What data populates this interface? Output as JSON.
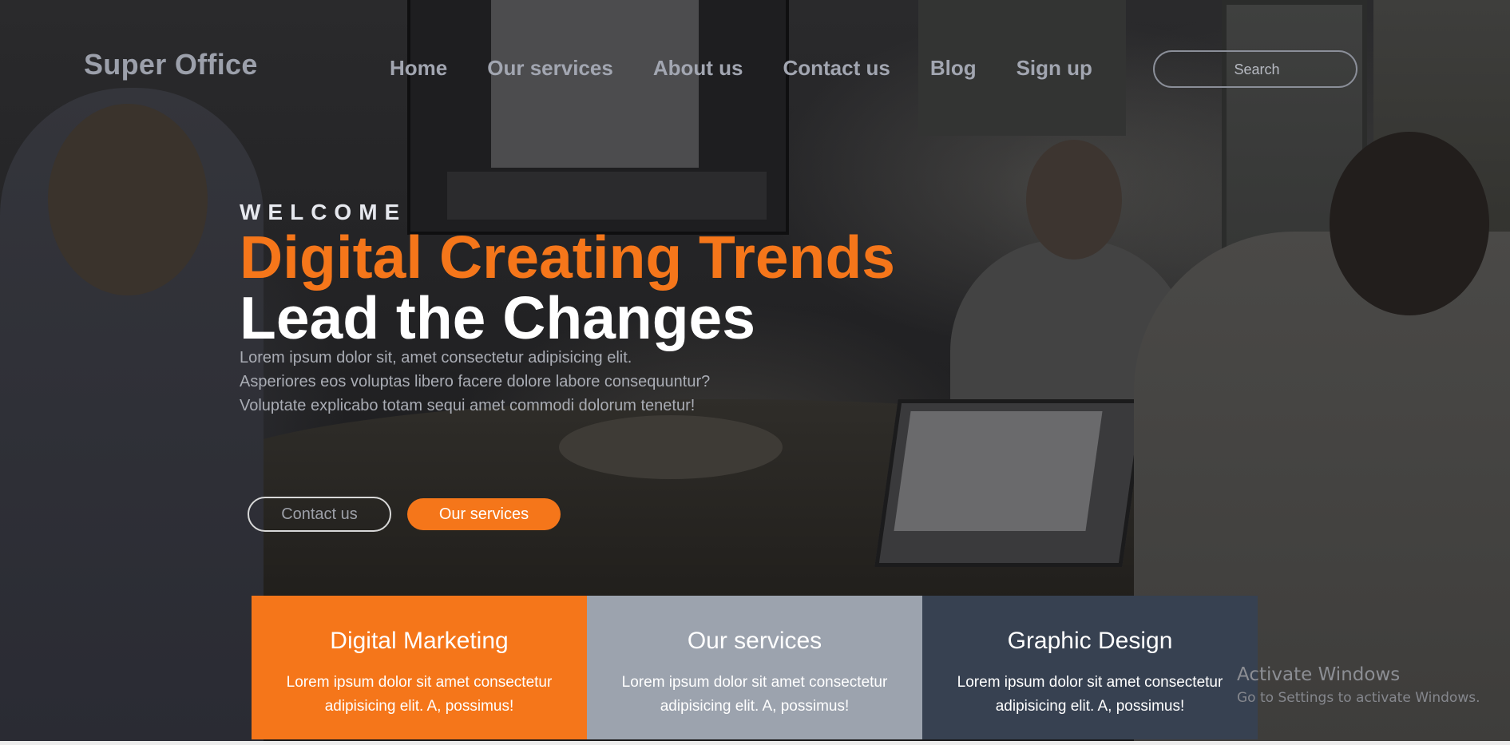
{
  "brand": "Super Office",
  "nav": {
    "items": [
      "Home",
      "Our services",
      "About us",
      "Contact us",
      "Blog",
      "Sign up"
    ]
  },
  "search": {
    "placeholder": "Search",
    "value": ""
  },
  "hero": {
    "kicker": "WELCOME",
    "headline_accent": "Digital Creating Trends",
    "headline_main": "Lead the Changes",
    "description_lines": [
      "Lorem ipsum dolor sit, amet consectetur adipisicing elit.",
      "Asperiores eos voluptas libero facere dolore labore consequuntur?",
      "Voluptate explicabo totam sequi amet commodi dolorum tenetur!"
    ],
    "btn_contact": "Contact us",
    "btn_services": "Our services"
  },
  "cards": [
    {
      "title": "Digital Marketing",
      "text": "Lorem ipsum dolor sit amet consectetur adipisicing elit. A, possimus!",
      "color": "#f5761a"
    },
    {
      "title": "Our services",
      "text": "Lorem ipsum dolor sit amet consectetur adipisicing elit. A, possimus!",
      "color": "#9ca3ae"
    },
    {
      "title": "Graphic Design",
      "text": "Lorem ipsum dolor sit amet consectetur adipisicing elit. A, possimus!",
      "color": "#374151"
    }
  ],
  "watermark": {
    "title": "Activate Windows",
    "subtitle": "Go to Settings to activate Windows."
  },
  "colors": {
    "accent": "#f5761a",
    "nav_text": "#a2a6b1"
  }
}
